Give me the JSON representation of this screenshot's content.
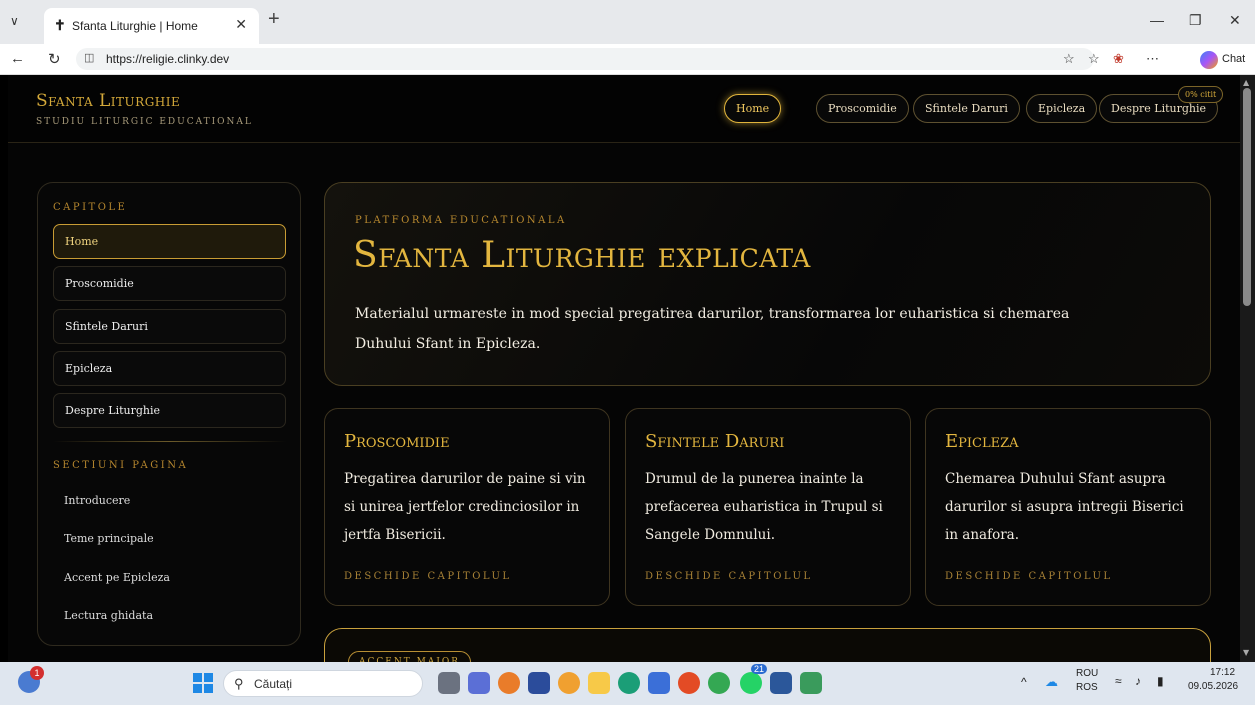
{
  "browser": {
    "tab_title": "Sfanta Liturghie | Home",
    "url": "https://religie.clinky.dev",
    "chat_label": "Chat"
  },
  "site": {
    "brand": "Sfanta Liturghie",
    "tagline": "STUDIU LITURGIC EDUCATIONAL",
    "read_progress": "0% citit",
    "nav": [
      "Home",
      "Proscomidie",
      "Sfintele Daruri",
      "Epicleza",
      "Despre Liturghie"
    ],
    "active_nav": "Home"
  },
  "sidebar": {
    "chapters_heading": "CAPITOLE",
    "chapters": [
      "Home",
      "Proscomidie",
      "Sfintele Daruri",
      "Epicleza",
      "Despre Liturghie"
    ],
    "sections_heading": "SECTIUNI PAGINA",
    "sections": [
      "Introducere",
      "Teme principale",
      "Accent pe Epicleza",
      "Lectura ghidata"
    ]
  },
  "hero": {
    "kicker": "PLATFORMA EDUCATIONALA",
    "title": "Sfanta Liturghie explicata",
    "description": "Materialul urmareste in mod special pregatirea darurilor, transformarea lor euharistica si chemarea Duhului Sfant in Epicleza."
  },
  "cards": [
    {
      "title": "Proscomidie",
      "text": "Pregatirea darurilor de paine si vin si unirea jertfelor credinciosilor in jertfa Bisericii.",
      "link": "DESCHIDE CAPITOLUL"
    },
    {
      "title": "Sfintele Daruri",
      "text": "Drumul de la punerea inainte la prefacerea euharistica in Trupul si Sangele Domnului.",
      "link": "DESCHIDE CAPITOLUL"
    },
    {
      "title": "Epicleza",
      "text": "Chemarea Duhului Sfant asupra darurilor si asupra intregii Biserici in anafora.",
      "link": "DESCHIDE CAPITOLUL"
    }
  ],
  "accent": {
    "pill": "ACCENT MAJOR"
  },
  "taskbar": {
    "search_placeholder": "Căutați",
    "weather_badge": "1",
    "whatsapp_badge": "21",
    "lang_top": "ROU",
    "lang_bottom": "ROS",
    "time": "17:12",
    "date": "09.05.2026"
  },
  "colors": {
    "gold": "#e3b63f",
    "background": "#050505",
    "taskbar": "#dfe6ef"
  }
}
